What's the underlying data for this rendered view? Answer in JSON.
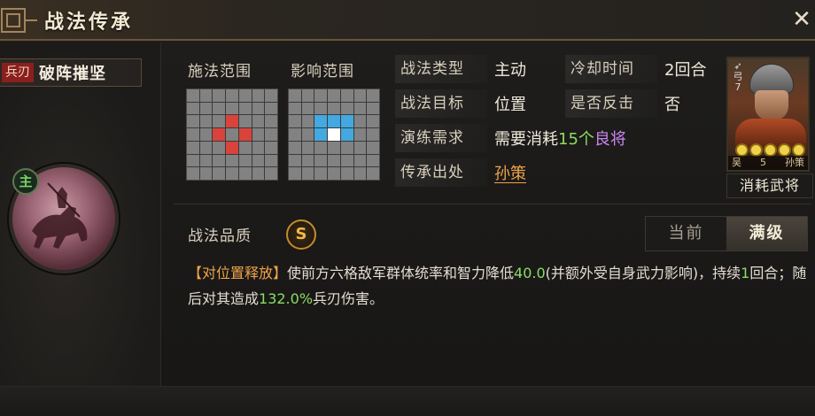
{
  "window": {
    "title": "战法传承",
    "close_icon": "close-icon"
  },
  "skill": {
    "type_tag": "兵刃",
    "name": "破阵摧坚",
    "role_badge": "主"
  },
  "range": {
    "cast_label": "施法范围",
    "effect_label": "影响范围",
    "cast_grid": {
      "cols": 7,
      "rows": 7,
      "red_cells": [
        [
          3,
          2
        ],
        [
          2,
          3
        ],
        [
          4,
          3
        ],
        [
          3,
          4
        ]
      ]
    },
    "effect_grid": {
      "cols": 7,
      "rows": 7,
      "blue_cells": [
        [
          2,
          2
        ],
        [
          3,
          2
        ],
        [
          4,
          2
        ],
        [
          2,
          3
        ],
        [
          4,
          3
        ]
      ],
      "white_cells": [
        [
          3,
          3
        ]
      ]
    }
  },
  "info": {
    "type_label": "战法类型",
    "type_value": "主动",
    "cooldown_label": "冷却时间",
    "cooldown_value": "2回合",
    "target_label": "战法目标",
    "target_value": "位置",
    "counter_label": "是否反击",
    "counter_value": "否",
    "practice_label": "演练需求",
    "practice_prefix": "需要消耗",
    "practice_count": "15个",
    "practice_item": "良将",
    "source_label": "传承出处",
    "source_value": "孙策"
  },
  "general_card": {
    "troop": "弓",
    "level": "7",
    "stars": 5,
    "faction": "吴",
    "cost": "5",
    "name": "孙策",
    "caption": "消耗武将"
  },
  "quality": {
    "label": "战法品质",
    "grade": "S"
  },
  "tabs": [
    {
      "label": "当前",
      "active": false
    },
    {
      "label": "满级",
      "active": true
    }
  ],
  "description": {
    "tag": "【对位置释放】",
    "part1": "使前方六格敌军群体统率和智力降低",
    "value1": "40.0",
    "part2": "(并额外受自身武力影响)，持续",
    "value2": "1",
    "part3": "回合；随后对其造成",
    "value3": "132.0%",
    "part4": "兵刃伤害。"
  },
  "colors": {
    "accent_orange": "#f0a44a",
    "green": "#8bdc63",
    "purple": "#c886f0",
    "red_cell": "#d9433c",
    "blue_cell": "#43a9e0"
  }
}
